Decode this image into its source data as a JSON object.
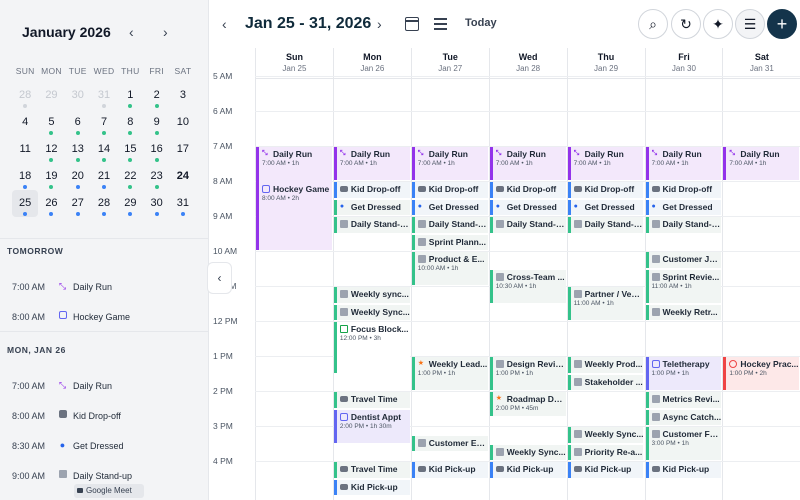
{
  "mini_calendar": {
    "title": "January 2026",
    "prev": "‹",
    "next": "›",
    "weekdays": [
      "SUN",
      "MON",
      "TUE",
      "WED",
      "THU",
      "FRI",
      "SAT"
    ],
    "weeks": [
      [
        {
          "d": "28",
          "m": 1,
          "dot": "m"
        },
        {
          "d": "29",
          "m": 1
        },
        {
          "d": "30",
          "m": 1
        },
        {
          "d": "31",
          "m": 1,
          "dot": "m"
        },
        {
          "d": "1",
          "dot": "g"
        },
        {
          "d": "2",
          "dot": "g"
        },
        {
          "d": "3"
        }
      ],
      [
        {
          "d": "4"
        },
        {
          "d": "5",
          "dot": "g"
        },
        {
          "d": "6",
          "dot": "g"
        },
        {
          "d": "7",
          "dot": "g"
        },
        {
          "d": "8",
          "dot": "g"
        },
        {
          "d": "9",
          "dot": "g"
        },
        {
          "d": "10"
        }
      ],
      [
        {
          "d": "11"
        },
        {
          "d": "12",
          "dot": "g"
        },
        {
          "d": "13",
          "dot": "g"
        },
        {
          "d": "14",
          "dot": "g"
        },
        {
          "d": "15",
          "dot": "g"
        },
        {
          "d": "16",
          "dot": "g"
        },
        {
          "d": "17"
        }
      ],
      [
        {
          "d": "18",
          "dot": "b"
        },
        {
          "d": "19",
          "dot": "g"
        },
        {
          "d": "20",
          "dot": "b"
        },
        {
          "d": "21",
          "dot": "b"
        },
        {
          "d": "22",
          "dot": "g"
        },
        {
          "d": "23",
          "dot": "g"
        },
        {
          "d": "24",
          "bold": 1
        }
      ],
      [
        {
          "d": "25",
          "sel": 1,
          "dot": "b"
        },
        {
          "d": "26",
          "dot": "b"
        },
        {
          "d": "27",
          "dot": "b"
        },
        {
          "d": "28",
          "dot": "b"
        },
        {
          "d": "29",
          "dot": "b"
        },
        {
          "d": "30",
          "dot": "b"
        },
        {
          "d": "31",
          "dot": "b"
        }
      ]
    ]
  },
  "agenda": {
    "tomorrow_header": "TOMORROW",
    "mon_header": "MON, JAN 26",
    "tomorrow": [
      {
        "time": "7:00 AM",
        "title": "Daily Run",
        "icon": "run"
      },
      {
        "time": "8:00 AM",
        "title": "Hockey Game",
        "icon": "hplus"
      }
    ],
    "mon": [
      {
        "time": "7:00 AM",
        "title": "Daily Run",
        "icon": "run"
      },
      {
        "time": "8:00 AM",
        "title": "Kid Drop-off",
        "icon": "car"
      },
      {
        "time": "8:30 AM",
        "title": "Get Dressed",
        "icon": "person"
      },
      {
        "time": "9:00 AM",
        "title": "Daily Stand-up",
        "icon": "bldg"
      }
    ],
    "meet_chip": "Google Meet"
  },
  "toolbar": {
    "prev": "‹",
    "next": "›",
    "range_title": "Jan 25 - 31, 2026",
    "today_label": "Today",
    "search_icon": "⌕",
    "refresh_icon": "↻",
    "ai_icon": "✦",
    "filter_icon": "☰",
    "add_icon": "+"
  },
  "collapse_icon": "‹",
  "days": [
    {
      "name": "Sun",
      "date": "Jan 25"
    },
    {
      "name": "Mon",
      "date": "Jan 26"
    },
    {
      "name": "Tue",
      "date": "Jan 27"
    },
    {
      "name": "Wed",
      "date": "Jan 28"
    },
    {
      "name": "Thu",
      "date": "Jan 29"
    },
    {
      "name": "Fri",
      "date": "Jan 30"
    },
    {
      "name": "Sat",
      "date": "Jan 31"
    }
  ],
  "hours": [
    "5 AM",
    "6 AM",
    "7 AM",
    "8 AM",
    "9 AM",
    "10 AM",
    "11 AM",
    "12 PM",
    "1 PM",
    "2 PM",
    "3 PM",
    "4 PM"
  ],
  "events": [
    {
      "day": 0,
      "start": 7.0,
      "dur": 3.0,
      "title": "Daily Run",
      "sub": "7:00 AM • 1h",
      "kind": "run",
      "icon": "run"
    },
    {
      "day": 0,
      "start": 8.0,
      "dur": 0.6,
      "title": "Hockey Game",
      "sub": "8:00 AM • 2h",
      "kind": "hockey",
      "icon": "hplus",
      "inside": 1
    },
    {
      "day": 1,
      "start": 7.0,
      "dur": 1.0,
      "title": "Daily Run",
      "sub": "7:00 AM • 1h",
      "kind": "run",
      "icon": "run"
    },
    {
      "day": 1,
      "start": 8.0,
      "dur": 0.5,
      "title": "Kid Drop-off",
      "kind": "blue",
      "icon": "car"
    },
    {
      "day": 1,
      "start": 8.5,
      "dur": 0.5,
      "title": "Get Dressed",
      "kind": "green",
      "icon": "person"
    },
    {
      "day": 1,
      "start": 9.0,
      "dur": 0.5,
      "title": "Daily Stand-up",
      "kind": "green",
      "icon": "bldg"
    },
    {
      "day": 1,
      "start": 11.0,
      "dur": 0.5,
      "title": "Weekly sync...",
      "kind": "green",
      "icon": "bldg"
    },
    {
      "day": 1,
      "start": 11.5,
      "dur": 0.5,
      "title": "Weekly Sync...",
      "kind": "green",
      "icon": "bldg"
    },
    {
      "day": 1,
      "start": 12.0,
      "dur": 1.5,
      "title": "Focus Block...",
      "sub": "12:00 PM • 3h",
      "kind": "plain",
      "icon": "cal"
    },
    {
      "day": 1,
      "start": 14.0,
      "dur": 0.5,
      "title": "Travel Time",
      "kind": "green",
      "icon": "car"
    },
    {
      "day": 1,
      "start": 14.5,
      "dur": 1.0,
      "title": "Dentist Appt",
      "sub": "2:00 PM • 1h 30m",
      "kind": "hockey",
      "icon": "hplus"
    },
    {
      "day": 1,
      "start": 16.0,
      "dur": 0.5,
      "title": "Travel Time",
      "kind": "green",
      "icon": "car"
    },
    {
      "day": 1,
      "start": 16.5,
      "dur": 0.5,
      "title": "Kid Pick-up",
      "kind": "blue",
      "icon": "car"
    },
    {
      "day": 2,
      "start": 7.0,
      "dur": 1.0,
      "title": "Daily Run",
      "sub": "7:00 AM • 1h",
      "kind": "run",
      "icon": "run"
    },
    {
      "day": 2,
      "start": 8.0,
      "dur": 0.5,
      "title": "Kid Drop-off",
      "kind": "blue",
      "icon": "car"
    },
    {
      "day": 2,
      "start": 8.5,
      "dur": 0.5,
      "title": "Get Dressed",
      "kind": "blue",
      "icon": "person"
    },
    {
      "day": 2,
      "start": 9.0,
      "dur": 0.5,
      "title": "Daily Stand-up",
      "kind": "green",
      "icon": "bldg"
    },
    {
      "day": 2,
      "start": 9.5,
      "dur": 0.5,
      "title": "Sprint Plann...",
      "kind": "green",
      "icon": "bldg"
    },
    {
      "day": 2,
      "start": 10.0,
      "dur": 1.0,
      "title": "Product & E...",
      "sub": "10:00 AM • 1h",
      "kind": "green",
      "icon": "bldg"
    },
    {
      "day": 2,
      "start": 13.0,
      "dur": 1.0,
      "title": "Weekly Lead...",
      "sub": "1:00 PM • 1h",
      "kind": "green",
      "icon": "star"
    },
    {
      "day": 2,
      "start": 15.25,
      "dur": 0.5,
      "title": "Customer Es...",
      "kind": "green",
      "icon": "bldg"
    },
    {
      "day": 2,
      "start": 16.0,
      "dur": 0.5,
      "title": "Kid Pick-up",
      "kind": "blue",
      "icon": "car"
    },
    {
      "day": 3,
      "start": 7.0,
      "dur": 1.0,
      "title": "Daily Run",
      "sub": "7:00 AM • 1h",
      "kind": "run",
      "icon": "run"
    },
    {
      "day": 3,
      "start": 8.0,
      "dur": 0.5,
      "title": "Kid Drop-off",
      "kind": "blue",
      "icon": "car"
    },
    {
      "day": 3,
      "start": 8.5,
      "dur": 0.5,
      "title": "Get Dressed",
      "kind": "blue",
      "icon": "person"
    },
    {
      "day": 3,
      "start": 9.0,
      "dur": 0.5,
      "title": "Daily Stand-up",
      "kind": "green",
      "icon": "bldg"
    },
    {
      "day": 3,
      "start": 10.5,
      "dur": 1.0,
      "title": "Cross-Team ...",
      "sub": "10:30 AM • 1h",
      "kind": "green",
      "icon": "bldg"
    },
    {
      "day": 3,
      "start": 13.0,
      "dur": 1.0,
      "title": "Design Review",
      "sub": "1:00 PM • 1h",
      "kind": "green",
      "icon": "bldg"
    },
    {
      "day": 3,
      "start": 14.0,
      "dur": 0.75,
      "title": "Roadmap De...",
      "sub": "2:00 PM • 45m",
      "kind": "green",
      "icon": "star"
    },
    {
      "day": 3,
      "start": 15.5,
      "dur": 0.5,
      "title": "Weekly Sync...",
      "kind": "green",
      "icon": "bldg"
    },
    {
      "day": 3,
      "start": 16.0,
      "dur": 0.5,
      "title": "Kid Pick-up",
      "kind": "blue",
      "icon": "car"
    },
    {
      "day": 4,
      "start": 7.0,
      "dur": 1.0,
      "title": "Daily Run",
      "sub": "7:00 AM • 1h",
      "kind": "run",
      "icon": "run"
    },
    {
      "day": 4,
      "start": 8.0,
      "dur": 0.5,
      "title": "Kid Drop-off",
      "kind": "blue",
      "icon": "car"
    },
    {
      "day": 4,
      "start": 8.5,
      "dur": 0.5,
      "title": "Get Dressed",
      "kind": "blue",
      "icon": "person"
    },
    {
      "day": 4,
      "start": 9.0,
      "dur": 0.5,
      "title": "Daily Stand-up",
      "kind": "green",
      "icon": "bldg"
    },
    {
      "day": 4,
      "start": 11.0,
      "dur": 1.0,
      "title": "Partner / Ven...",
      "sub": "11:00 AM • 1h",
      "kind": "green",
      "icon": "bldg"
    },
    {
      "day": 4,
      "start": 13.0,
      "dur": 0.5,
      "title": "Weekly Prod...",
      "kind": "green",
      "icon": "bldg"
    },
    {
      "day": 4,
      "start": 13.5,
      "dur": 0.5,
      "title": "Stakeholder ...",
      "kind": "green",
      "icon": "bldg"
    },
    {
      "day": 4,
      "start": 15.0,
      "dur": 0.5,
      "title": "Weekly Sync...",
      "kind": "green",
      "icon": "bldg"
    },
    {
      "day": 4,
      "start": 15.5,
      "dur": 0.5,
      "title": "Priority Re-a...",
      "kind": "green",
      "icon": "bldg"
    },
    {
      "day": 4,
      "start": 16.0,
      "dur": 0.5,
      "title": "Kid Pick-up",
      "kind": "blue",
      "icon": "car"
    },
    {
      "day": 5,
      "start": 7.0,
      "dur": 1.0,
      "title": "Daily Run",
      "sub": "7:00 AM • 1h",
      "kind": "run",
      "icon": "run"
    },
    {
      "day": 5,
      "start": 8.0,
      "dur": 0.5,
      "title": "Kid Drop-off",
      "kind": "blue",
      "icon": "car"
    },
    {
      "day": 5,
      "start": 8.5,
      "dur": 0.5,
      "title": "Get Dressed",
      "kind": "blue",
      "icon": "person"
    },
    {
      "day": 5,
      "start": 9.0,
      "dur": 0.5,
      "title": "Daily Stand-up",
      "kind": "green",
      "icon": "bldg"
    },
    {
      "day": 5,
      "start": 10.0,
      "dur": 0.5,
      "title": "Customer Jo...",
      "kind": "green",
      "icon": "bldg"
    },
    {
      "day": 5,
      "start": 10.5,
      "dur": 1.0,
      "title": "Sprint Revie...",
      "sub": "11:00 AM • 1h",
      "kind": "green",
      "icon": "bldg"
    },
    {
      "day": 5,
      "start": 11.5,
      "dur": 0.5,
      "title": "Weekly Retr...",
      "kind": "green",
      "icon": "bldg"
    },
    {
      "day": 5,
      "start": 13.0,
      "dur": 1.0,
      "title": "Teletherapy",
      "sub": "1:00 PM • 1h",
      "kind": "hockey",
      "icon": "hplus"
    },
    {
      "day": 5,
      "start": 14.0,
      "dur": 0.5,
      "title": "Metrics Revi...",
      "kind": "green",
      "icon": "bldg"
    },
    {
      "day": 5,
      "start": 14.5,
      "dur": 0.5,
      "title": "Async Catch...",
      "kind": "green",
      "icon": "bldg"
    },
    {
      "day": 5,
      "start": 15.0,
      "dur": 1.0,
      "title": "Customer Fe...",
      "sub": "3:00 PM • 1h",
      "kind": "green",
      "icon": "bldg"
    },
    {
      "day": 5,
      "start": 16.0,
      "dur": 0.5,
      "title": "Kid Pick-up",
      "kind": "blue",
      "icon": "car"
    },
    {
      "day": 6,
      "start": 7.0,
      "dur": 1.0,
      "title": "Daily Run",
      "sub": "7:00 AM • 1h",
      "kind": "run",
      "icon": "run"
    },
    {
      "day": 6,
      "start": 13.0,
      "dur": 1.0,
      "title": "Hockey Prac...",
      "sub": "1:00 PM • 2h",
      "kind": "hockey-red",
      "icon": "globe"
    }
  ]
}
